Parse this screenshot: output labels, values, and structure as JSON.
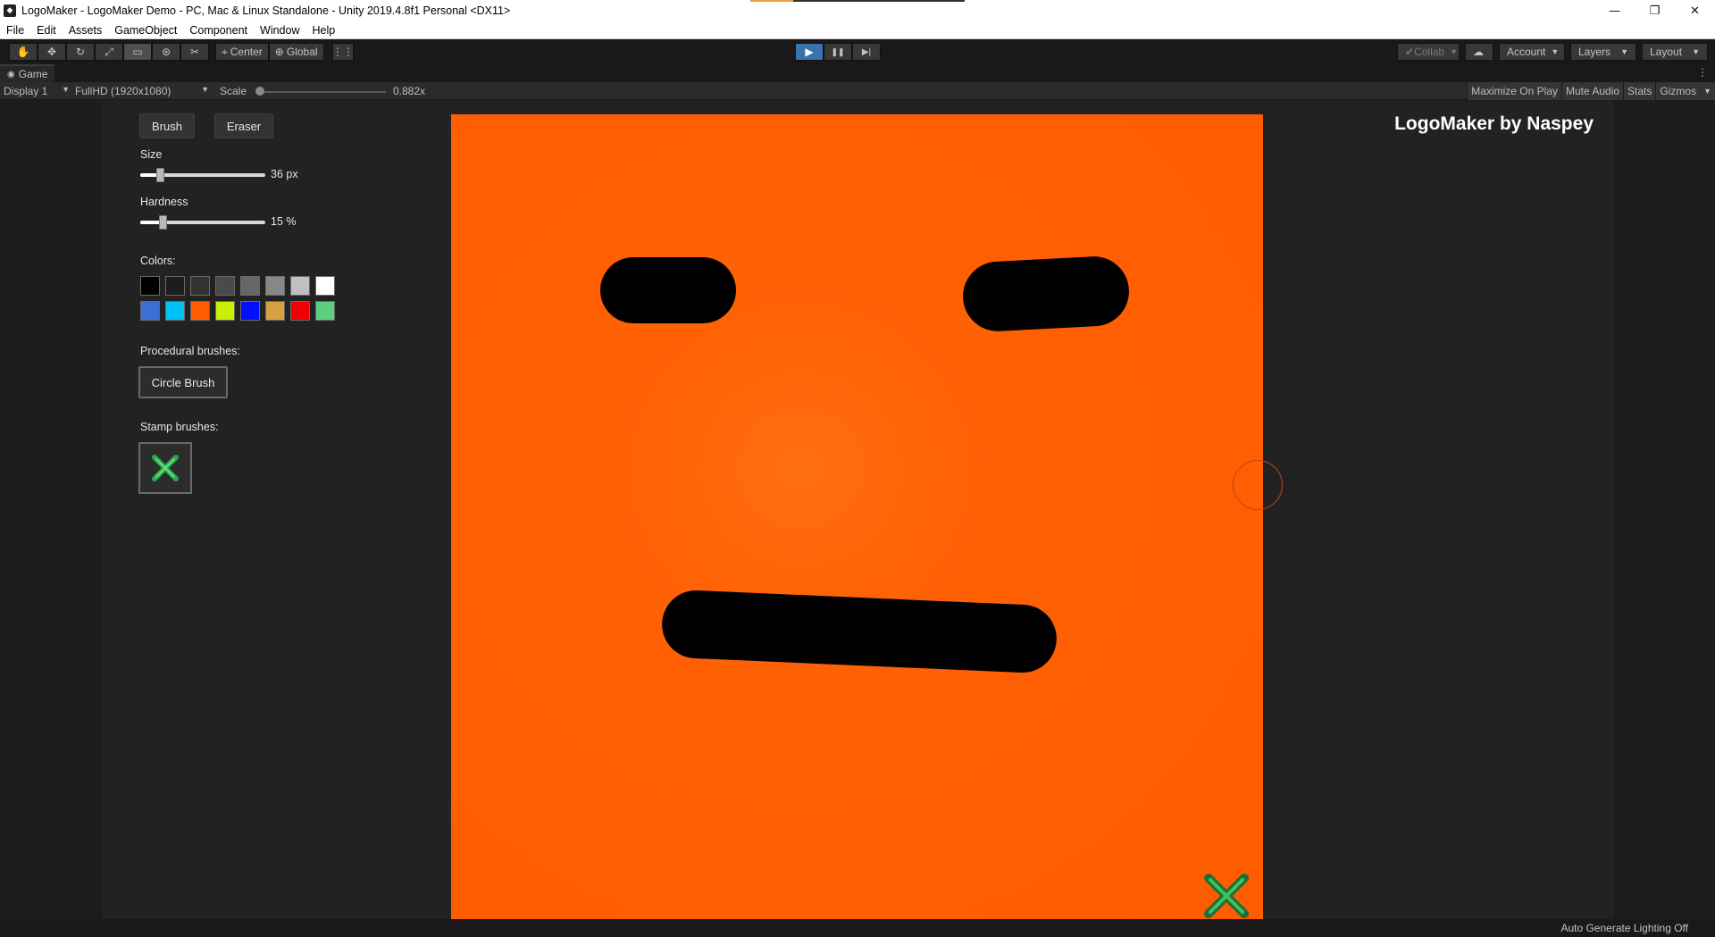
{
  "window": {
    "title": "LogoMaker - LogoMaker Demo - PC, Mac & Linux Standalone - Unity 2019.4.8f1 Personal <DX11>",
    "minimize_glyph": "—",
    "restore_glyph": "❐",
    "close_glyph": "✕"
  },
  "menu": [
    "File",
    "Edit",
    "Assets",
    "GameObject",
    "Component",
    "Window",
    "Help"
  ],
  "toolbar": {
    "tools": [
      {
        "icon": "hand-tool-icon",
        "glyph": "✋"
      },
      {
        "icon": "move-tool-icon",
        "glyph": "✥"
      },
      {
        "icon": "rotate-tool-icon",
        "glyph": "↻"
      },
      {
        "icon": "scale-tool-icon",
        "glyph": "⤢"
      },
      {
        "icon": "rect-tool-icon",
        "glyph": "▭"
      },
      {
        "icon": "transform-tool-icon",
        "glyph": "⊛"
      },
      {
        "icon": "custom-tool-icon",
        "glyph": "✂"
      }
    ],
    "pivot_label": "Center",
    "space_label": "Global",
    "collab_label": "Collab",
    "account_label": "Account",
    "layers_label": "Layers",
    "layout_label": "Layout",
    "play_glyph": "▶",
    "pause_glyph": "❚❚",
    "step_glyph": "▶|"
  },
  "game_tab": {
    "label": "Game",
    "display": "Display 1",
    "resolution": "FullHD (1920x1080)",
    "scale_label": "Scale",
    "scale_value": "0.882x",
    "maximize": "Maximize On Play",
    "mute": "Mute Audio",
    "stats": "Stats",
    "gizmos": "Gizmos"
  },
  "app": {
    "title": "LogoMaker by Naspey",
    "brush_label": "Brush",
    "eraser_label": "Eraser",
    "size_label": "Size",
    "size_value": "36 px",
    "size_fraction": 0.16,
    "hardness_label": "Hardness",
    "hardness_value": "15 %",
    "hardness_fraction": 0.18,
    "colors_label": "Colors:",
    "colors_row1": [
      "#000000",
      "#1c1c1c",
      "#333333",
      "#4a4a4a",
      "#666666",
      "#888888",
      "#c0c0c0",
      "#ffffff"
    ],
    "colors_row2": [
      "#3c6fd6",
      "#00c0f8",
      "#ff5c00",
      "#c8f000",
      "#0010ff",
      "#d8a040",
      "#f00000",
      "#5ad080"
    ],
    "procedural_label": "Procedural brushes:",
    "circle_brush_label": "Circle Brush",
    "stamp_label": "Stamp brushes:",
    "canvas_color": "#ff5c00",
    "stroke_color": "#000000"
  },
  "status": {
    "text": "Auto Generate Lighting Off"
  }
}
